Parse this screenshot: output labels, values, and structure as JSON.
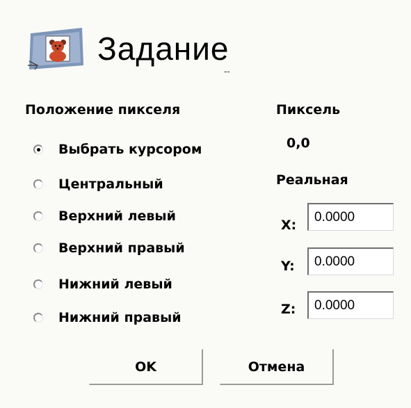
{
  "header": {
    "title": "Задание",
    "subtitle": "--",
    "icon": "teddy-bear-icon"
  },
  "pixel_position": {
    "label": "Положение пикселя",
    "options": [
      {
        "label": "Выбрать курсором",
        "checked": true
      },
      {
        "label": "Центральный",
        "checked": false
      },
      {
        "label": "Верхний левый",
        "checked": false
      },
      {
        "label": "Верхний правый",
        "checked": false
      },
      {
        "label": "Нижний левый",
        "checked": false
      },
      {
        "label": "Нижний правый",
        "checked": false
      }
    ]
  },
  "pixel": {
    "label": "Пиксель",
    "value": "0,0"
  },
  "real": {
    "label": "Реальная",
    "x_label": "X:",
    "x_value": "0.0000",
    "y_label": "Y:",
    "y_value": "0.0000",
    "z_label": "Z:",
    "z_value": "0.0000"
  },
  "buttons": {
    "ok": "OK",
    "cancel": "Отмена"
  }
}
